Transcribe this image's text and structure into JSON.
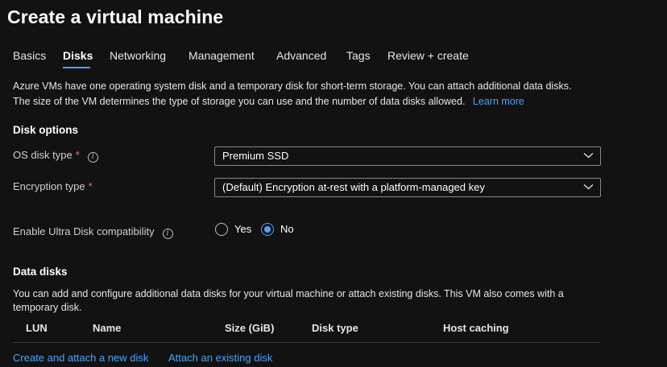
{
  "page": {
    "title": "Create a virtual machine"
  },
  "tabs": [
    {
      "label": "Basics"
    },
    {
      "label": "Disks",
      "active": true
    },
    {
      "label": "Networking"
    },
    {
      "label": "Management"
    },
    {
      "label": "Advanced"
    },
    {
      "label": "Tags"
    },
    {
      "label": "Review + create"
    }
  ],
  "intro": {
    "line1": "Azure VMs have one operating system disk and a temporary disk for short-term storage. You can attach additional data disks.",
    "line2": "The size of the VM determines the type of storage you can use and the number of data disks allowed.",
    "learn_more": "Learn more"
  },
  "disk_options": {
    "heading": "Disk options",
    "os_disk_type": {
      "label": "OS disk type",
      "required_mark": "*",
      "value": "Premium SSD"
    },
    "encryption_type": {
      "label": "Encryption type",
      "required_mark": "*",
      "value": "(Default) Encryption at-rest with a platform-managed key"
    },
    "ultra_disk": {
      "label": "Enable Ultra Disk compatibility",
      "options": [
        {
          "label": "Yes",
          "checked": false
        },
        {
          "label": "No",
          "checked": true
        }
      ]
    }
  },
  "data_disks": {
    "heading": "Data disks",
    "description": "You can add and configure additional data disks for your virtual machine or attach existing disks. This VM also comes with a temporary disk.",
    "columns": [
      "LUN",
      "Name",
      "Size (GiB)",
      "Disk type",
      "Host caching"
    ],
    "create_link": "Create and attach a new disk",
    "attach_link": "Attach an existing disk"
  },
  "colors": {
    "accent": "#4fa3f7",
    "required": "#f1707b",
    "background": "#121212"
  },
  "icons": {
    "info": "info-circle-icon",
    "dropdown": "chevron-down-icon"
  }
}
